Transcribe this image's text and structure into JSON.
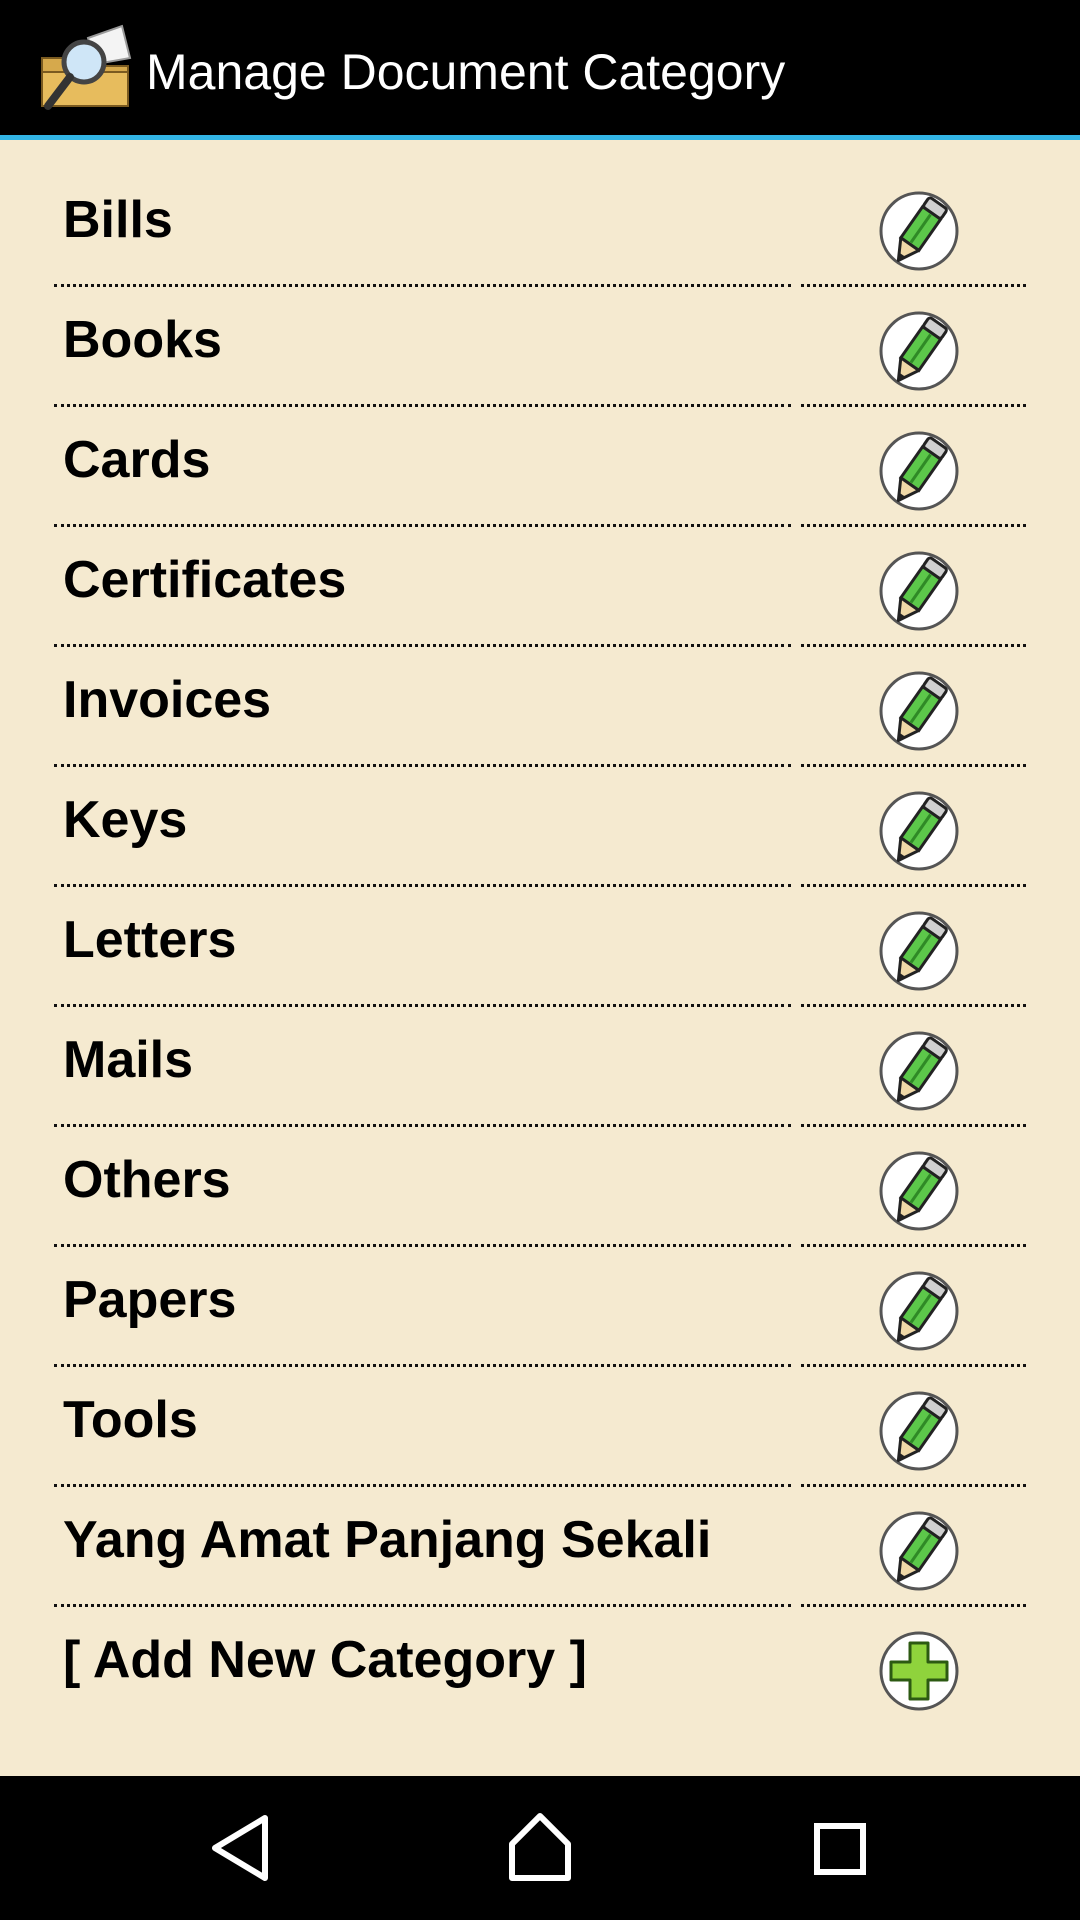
{
  "header": {
    "title": "Manage Document Category",
    "icon": "folder-magnifier-icon"
  },
  "categories": [
    {
      "label": "Bills",
      "action_icon": "edit-pencil-icon"
    },
    {
      "label": "Books",
      "action_icon": "edit-pencil-icon"
    },
    {
      "label": "Cards",
      "action_icon": "edit-pencil-icon"
    },
    {
      "label": "Certificates",
      "action_icon": "edit-pencil-icon"
    },
    {
      "label": "Invoices",
      "action_icon": "edit-pencil-icon"
    },
    {
      "label": "Keys",
      "action_icon": "edit-pencil-icon"
    },
    {
      "label": "Letters",
      "action_icon": "edit-pencil-icon"
    },
    {
      "label": "Mails",
      "action_icon": "edit-pencil-icon"
    },
    {
      "label": "Others",
      "action_icon": "edit-pencil-icon"
    },
    {
      "label": "Papers",
      "action_icon": "edit-pencil-icon"
    },
    {
      "label": "Tools",
      "action_icon": "edit-pencil-icon"
    },
    {
      "label": "Yang Amat Panjang Sekali",
      "action_icon": "edit-pencil-icon"
    }
  ],
  "add_category": {
    "label": "[ Add New Category ]",
    "action_icon": "add-plus-icon"
  },
  "navbar": {
    "back_icon": "back-icon",
    "home_icon": "home-icon",
    "recents_icon": "recents-icon"
  },
  "colors": {
    "background": "#f5ead0",
    "titlebar": "#000000",
    "accent": "#33b5e5",
    "pencil_green": "#5cc84a",
    "plus_green": "#8fd33c"
  }
}
